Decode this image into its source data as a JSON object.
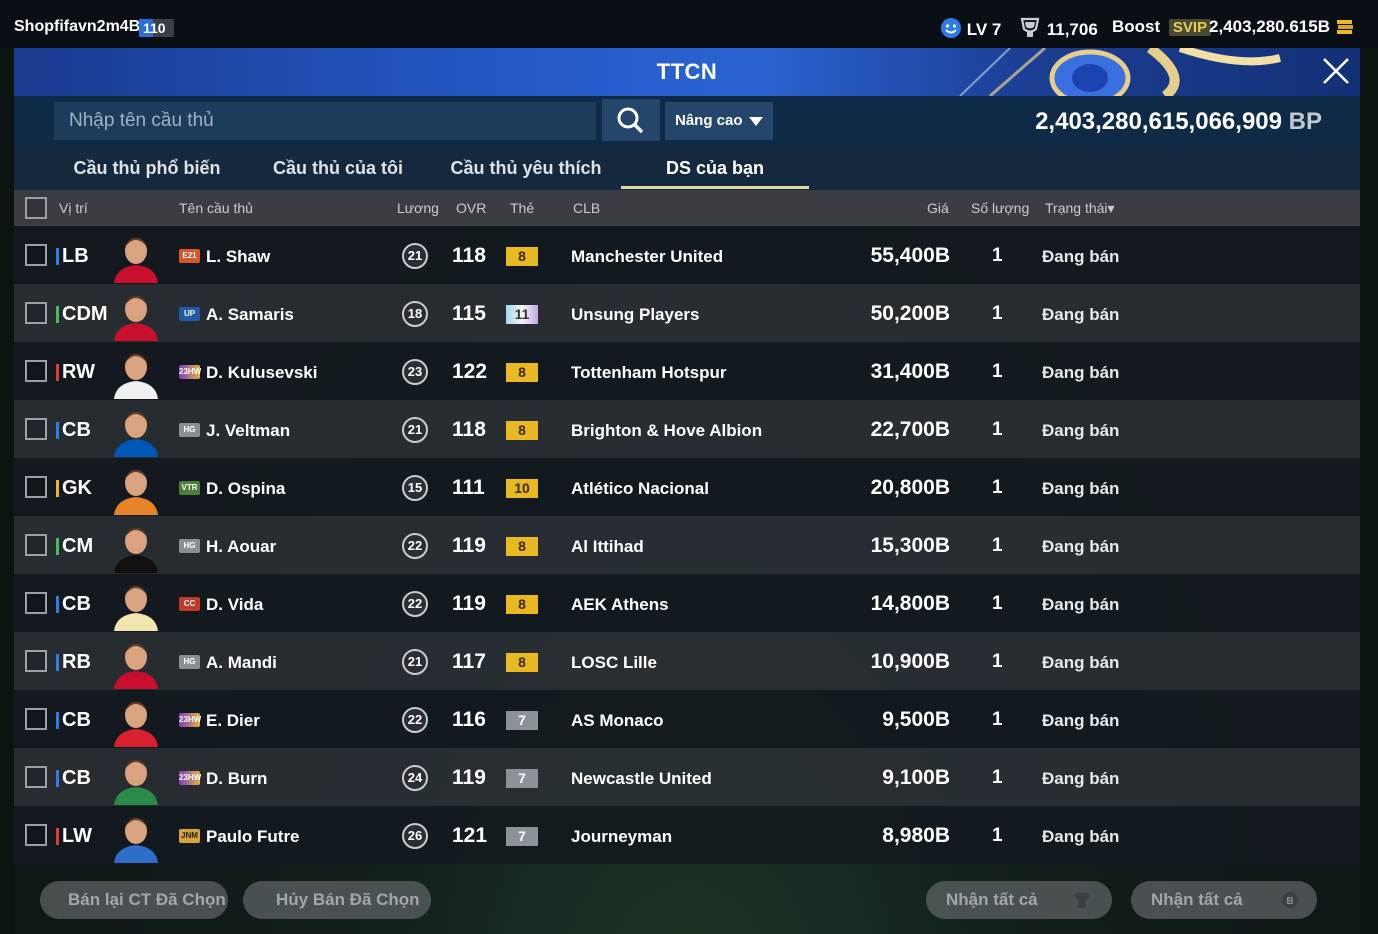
{
  "topbar": {
    "username": "Shopfifavn2m4B",
    "level_badge": "110",
    "level": "LV 7",
    "trophies": "11,706",
    "boost_label": "Boost",
    "svip_label": "SVIP",
    "currency": "2,403,280.615B"
  },
  "header": {
    "title": "TTCN"
  },
  "search": {
    "placeholder": "Nhập tên cầu thủ",
    "advanced_label": "Nâng cao",
    "bp_amount": "2,403,280,615,066,909",
    "bp_unit": "BP"
  },
  "tabs": [
    {
      "label": "Cầu thủ phổ biến",
      "active": false
    },
    {
      "label": "Cầu thủ của tôi",
      "active": false
    },
    {
      "label": "Cầu thủ yêu thích",
      "active": false
    },
    {
      "label": "DS của bạn",
      "active": true
    }
  ],
  "table": {
    "headers": {
      "position": "Vị trí",
      "name": "Tên cầu thủ",
      "salary": "Lương",
      "ovr": "OVR",
      "grade": "Thẻ",
      "club": "CLB",
      "price": "Giá",
      "quantity": "Số lượng",
      "status": "Trạng thái▾"
    },
    "rows": [
      {
        "position": "LB",
        "pos_color": "#2f7bea",
        "season": "E21",
        "name": "L. Shaw",
        "salary": "21",
        "ovr": "118",
        "grade": "8",
        "club": "Manchester United",
        "price": "55,400B",
        "quantity": "1",
        "status": "Đang bán"
      },
      {
        "position": "CDM",
        "pos_color": "#3fbf5a",
        "season": "UP",
        "name": "A. Samaris",
        "salary": "18",
        "ovr": "115",
        "grade": "11",
        "club": "Unsung Players",
        "price": "50,200B",
        "quantity": "1",
        "status": "Đang bán"
      },
      {
        "position": "RW",
        "pos_color": "#e0383b",
        "season": "23HW",
        "name": "D. Kulusevski",
        "salary": "23",
        "ovr": "122",
        "grade": "8",
        "club": "Tottenham Hotspur",
        "price": "31,400B",
        "quantity": "1",
        "status": "Đang bán"
      },
      {
        "position": "CB",
        "pos_color": "#2f7bea",
        "season": "HG",
        "name": "J. Veltman",
        "salary": "21",
        "ovr": "118",
        "grade": "8",
        "club": "Brighton & Hove Albion",
        "price": "22,700B",
        "quantity": "1",
        "status": "Đang bán"
      },
      {
        "position": "GK",
        "pos_color": "#e8b923",
        "season": "VTR",
        "name": "D. Ospina",
        "salary": "15",
        "ovr": "111",
        "grade": "10",
        "club": "Atlético Nacional",
        "price": "20,800B",
        "quantity": "1",
        "status": "Đang bán"
      },
      {
        "position": "CM",
        "pos_color": "#3fbf5a",
        "season": "HG",
        "name": "H. Aouar",
        "salary": "22",
        "ovr": "119",
        "grade": "8",
        "club": "Al Ittihad",
        "price": "15,300B",
        "quantity": "1",
        "status": "Đang bán"
      },
      {
        "position": "CB",
        "pos_color": "#2f7bea",
        "season": "CC",
        "name": "D. Vida",
        "salary": "22",
        "ovr": "119",
        "grade": "8",
        "club": "AEK Athens",
        "price": "14,800B",
        "quantity": "1",
        "status": "Đang bán"
      },
      {
        "position": "RB",
        "pos_color": "#2f7bea",
        "season": "HG",
        "name": "A. Mandi",
        "salary": "21",
        "ovr": "117",
        "grade": "8",
        "club": "LOSC Lille",
        "price": "10,900B",
        "quantity": "1",
        "status": "Đang bán"
      },
      {
        "position": "CB",
        "pos_color": "#2f7bea",
        "season": "23HW",
        "name": "E. Dier",
        "salary": "22",
        "ovr": "116",
        "grade": "7",
        "club": "AS Monaco",
        "price": "9,500B",
        "quantity": "1",
        "status": "Đang bán"
      },
      {
        "position": "CB",
        "pos_color": "#2f7bea",
        "season": "23HW",
        "name": "D. Burn",
        "salary": "24",
        "ovr": "119",
        "grade": "7",
        "club": "Newcastle United",
        "price": "9,100B",
        "quantity": "1",
        "status": "Đang bán"
      },
      {
        "position": "LW",
        "pos_color": "#e0383b",
        "season": "JNM",
        "name": "Paulo Futre",
        "salary": "26",
        "ovr": "121",
        "grade": "7",
        "club": "Journeyman",
        "price": "8,980B",
        "quantity": "1",
        "status": "Đang bán"
      }
    ]
  },
  "footer": {
    "resell_selected": "Bán lại CT Đã Chọn",
    "cancel_selected": "Hủy Bán Đã Chọn",
    "claim_all_1": "Nhận tất cả",
    "claim_all_2": "Nhận tất cả"
  },
  "colors": {
    "grade_gold": "#e8b923",
    "grade_silver": "#8d9299",
    "grade_rainbow": "#a9d6f0"
  },
  "icons": {
    "search": "search-icon",
    "close": "close-icon",
    "level": "smiley-icon",
    "trophy": "trophy-icon",
    "bp_coin": "coin-icon",
    "claim_1": "shirt-icon",
    "claim_2": "bp-coin-icon"
  }
}
